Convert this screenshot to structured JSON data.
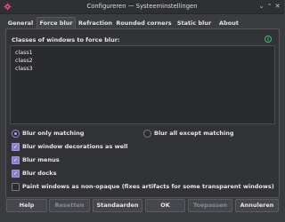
{
  "window": {
    "title": "Configureren — Systeeminstellingen",
    "controls": {
      "minimize": "⌄",
      "maximize": "⌃",
      "close": "✕"
    }
  },
  "tabs": [
    {
      "label": "General",
      "active": false
    },
    {
      "label": "Force blur",
      "active": true
    },
    {
      "label": "Refraction",
      "active": false
    },
    {
      "label": "Rounded corners",
      "active": false
    },
    {
      "label": "Static blur",
      "active": false
    },
    {
      "label": "About",
      "active": false
    }
  ],
  "panel": {
    "classes_label": "Classes of windows to force blur:",
    "classes_lines": [
      "class1",
      "class2",
      "class3"
    ],
    "radios": [
      {
        "label": "Blur only matching",
        "checked": true
      },
      {
        "label": "Blur all except matching",
        "checked": false
      }
    ],
    "checkboxes": [
      {
        "label": "Blur window decorations as well",
        "checked": true
      },
      {
        "label": "Blur menus",
        "checked": true
      },
      {
        "label": "Blur docks",
        "checked": true
      },
      {
        "label": "Paint windows as non-opaque (fixes artifacts for some transparent windows)",
        "checked": false
      }
    ],
    "checkmark": "✓"
  },
  "buttons": {
    "help": "Help",
    "reset": "Resetten",
    "defaults": "Standaarden",
    "ok": "OK",
    "apply": "Toepassen",
    "cancel": "Annuleren"
  },
  "colors": {
    "accent": "#8e7bd0",
    "background": "#3b3c40",
    "info_icon": "#3dbf6e"
  },
  "icons": {
    "app": "settings-app-icon",
    "info": "info-icon"
  }
}
